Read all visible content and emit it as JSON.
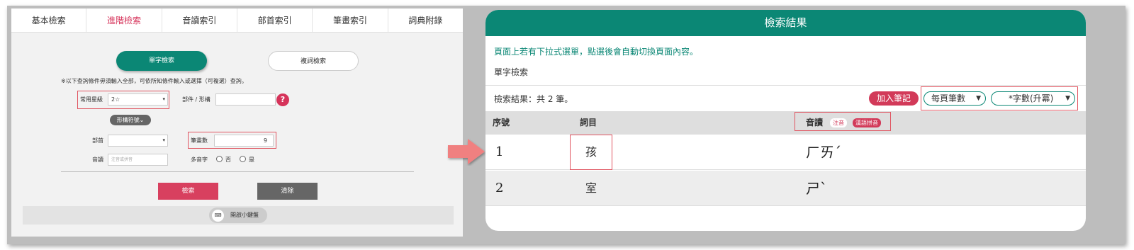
{
  "left_panel": {
    "tabs": [
      {
        "label": "基本檢索"
      },
      {
        "label": "進階檢索"
      },
      {
        "label": "音讀索引"
      },
      {
        "label": "部首索引"
      },
      {
        "label": "筆畫索引"
      },
      {
        "label": "詞典附錄"
      }
    ],
    "active_tab": "進階檢索",
    "mode_single": "單字檢索",
    "mode_multi": "複詞檢索",
    "note": "※以下查詢條件毋須輸入全部，可依所知條件輸入或選擇（可複選）查詢。",
    "freq_label": "常用星級",
    "freq_value": "2☆",
    "component_label": "部件 / 形構",
    "help_label": "?",
    "shape_button": "形構符號",
    "radical_label": "部首",
    "radical_value": "",
    "strokes_label": "筆畫數",
    "strokes_value": "9",
    "reading_label": "音讀",
    "reading_placeholder": "注音或拼音",
    "polyphone_label": "多音字",
    "opt_no": "否",
    "opt_yes": "是",
    "search_button": "檢索",
    "clear_button": "清除",
    "keyboard_button": "開啟小鍵盤",
    "keyboard_icon": "keyboard-icon"
  },
  "right_panel": {
    "header": "檢索結果",
    "info": "頁面上若有下拉式選單，點選後會自動切換頁面內容。",
    "subtitle": "單字檢索",
    "count_text": "檢索結果：共 2 筆。",
    "add_note": "加入筆記",
    "per_page": "每頁筆數",
    "sort": "*字數(升冪)",
    "columns": {
      "no": "序號",
      "entry": "詞目",
      "reading": "音讀"
    },
    "tag_zhuyin": "注音",
    "tag_pinyin": "漢語拼音",
    "rows": [
      {
        "no": "1",
        "entry": "孩",
        "zhuyin": "ㄏㄞˊ"
      },
      {
        "no": "2",
        "entry": "室",
        "zhuyin": "ㄕˋ"
      }
    ]
  },
  "colors": {
    "accent_green": "#0b8775",
    "accent_red": "#d23a59",
    "highlight_box": "#e05561"
  }
}
